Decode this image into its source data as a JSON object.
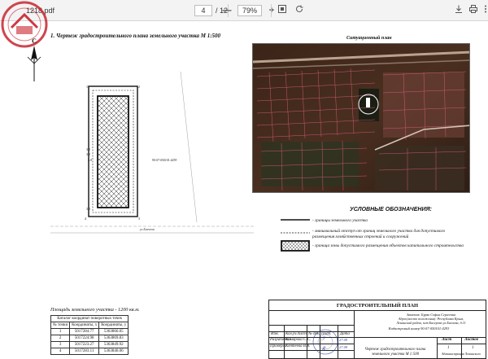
{
  "viewer": {
    "filename": "1218.pdf",
    "page_current": "4",
    "page_total": "/ 12",
    "zoom": "79%",
    "minus_label": "—",
    "plus_label": "+"
  },
  "logo": {
    "letter": "C"
  },
  "document": {
    "title": "1. Чертеж градостроительного плана земельного участка М 1:500",
    "situation_title": "Ситуационный план",
    "parcel_number": "90:07:050101:4293",
    "street_label": "ул.Бахчева",
    "dim_labels": [
      "3.0",
      "3.0",
      "3.0",
      "3.0"
    ],
    "legend": {
      "title": "УСЛОВНЫЕ ОБОЗНАЧЕНИЯ:",
      "items": [
        "- границы земельного участка",
        "- минимальный отступ от границ земельного участка для допустимого размещения хозяйственных строений и сооружений",
        "- граница зоны допустимого размещения объектов капитального строительства"
      ]
    },
    "area_text": "Площадь земельного участка - 1200 кв.м.",
    "coords": {
      "caption": "Каталог координат поворотных точек",
      "headers": [
        "№ точки",
        "Координаты, х",
        "Координаты, у"
      ],
      "rows": [
        [
          "1",
          "5017284.77",
          "5363866.05"
        ],
        [
          "2",
          "5017224.98",
          "5363869.83"
        ],
        [
          "3",
          "5017223.27",
          "5363849.92"
        ],
        [
          "4",
          "5017283.11",
          "5363846.06"
        ]
      ]
    },
    "stamp": {
      "header": "ГРАДОСТРОИТЕЛЬНЫЙ ПЛАН",
      "client_1": "Заказчик: Буряк Софья Сергеевна",
      "client_2": "Адрес(место положения): Республика Крым,",
      "client_3": "Ленинский район, пгт Багерово ул.Бахчева, д.11",
      "cadastral": "Кадастровый номер 90:07:050101:4293",
      "col_labels": [
        "Изм.",
        "Кол.уч",
        "Лист",
        "№ док.",
        "Подп.",
        "Дата"
      ],
      "role_1": "Разработал",
      "name_1": "Комарова С.С.",
      "role_2": "Проверил",
      "name_2": "Кентеева В.В.",
      "sign_date_1": "27.09",
      "sign_date_2": "27.09",
      "drawing": "Чертеж градостроительного плана",
      "drawing_scale": "земельного участка М 1:500",
      "sheet_label": "Лист",
      "sheets_label": "Листов",
      "sheet_no": "1",
      "sheets_no": "1",
      "admin": "Администрация Ленинского",
      "admin_2": "района Республики Крым"
    }
  },
  "colors": {
    "toolbar_bg": "#f3f3f3",
    "satellite_bg": "#2a1a13",
    "parcel_overlay": "#e06080",
    "stamp_blue": "#2a3b9a",
    "logo_red": "#c8242f"
  }
}
